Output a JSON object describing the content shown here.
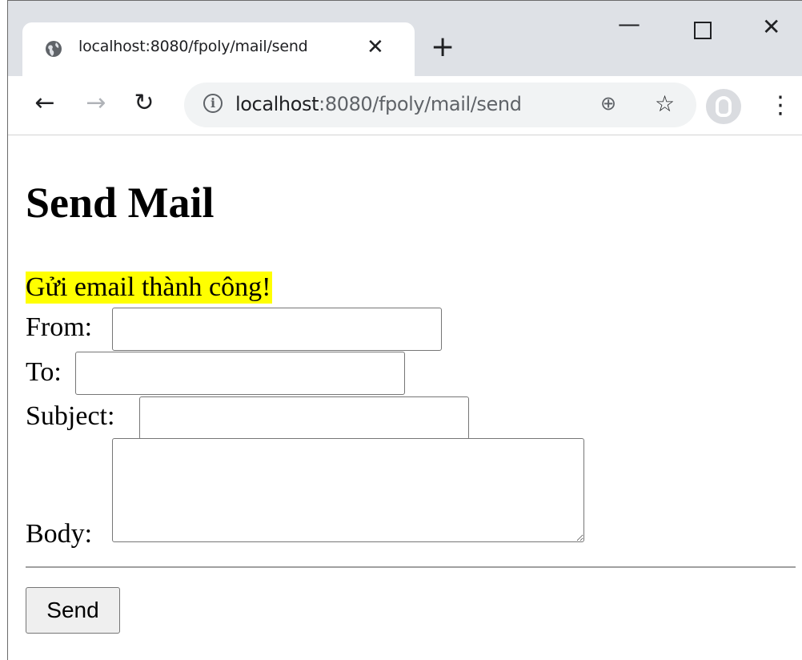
{
  "browser": {
    "tab_title": "localhost:8080/fpoly/mail/send",
    "tab_close": "✕",
    "new_tab": "+",
    "window_controls": {
      "minimize": "—",
      "maximize": "",
      "close": "✕"
    },
    "nav": {
      "back": "←",
      "forward": "→",
      "reload": "↻"
    },
    "address": {
      "host": "localhost",
      "rest": ":8080/fpoly/mail/send"
    },
    "icons": {
      "tab_favicon": "globe-icon",
      "info": "info-icon",
      "zoom": "zoom-icon",
      "bookmark": "star-icon",
      "profile": "avatar-icon",
      "menu": "kebab-menu-icon"
    },
    "info_glyph": "i",
    "zoom_glyph": "⊕",
    "star_glyph": "☆",
    "menu_glyph": "⋮"
  },
  "page": {
    "heading": "Send Mail",
    "message": "Gửi email thành công!",
    "message_color": "#ffff00",
    "form": {
      "from_label": "From:",
      "from_value": "",
      "to_label": "To:",
      "to_value": "",
      "subject_label": "Subject:",
      "subject_value": "",
      "body_label": "Body:",
      "body_value": "",
      "send_label": "Send"
    }
  }
}
